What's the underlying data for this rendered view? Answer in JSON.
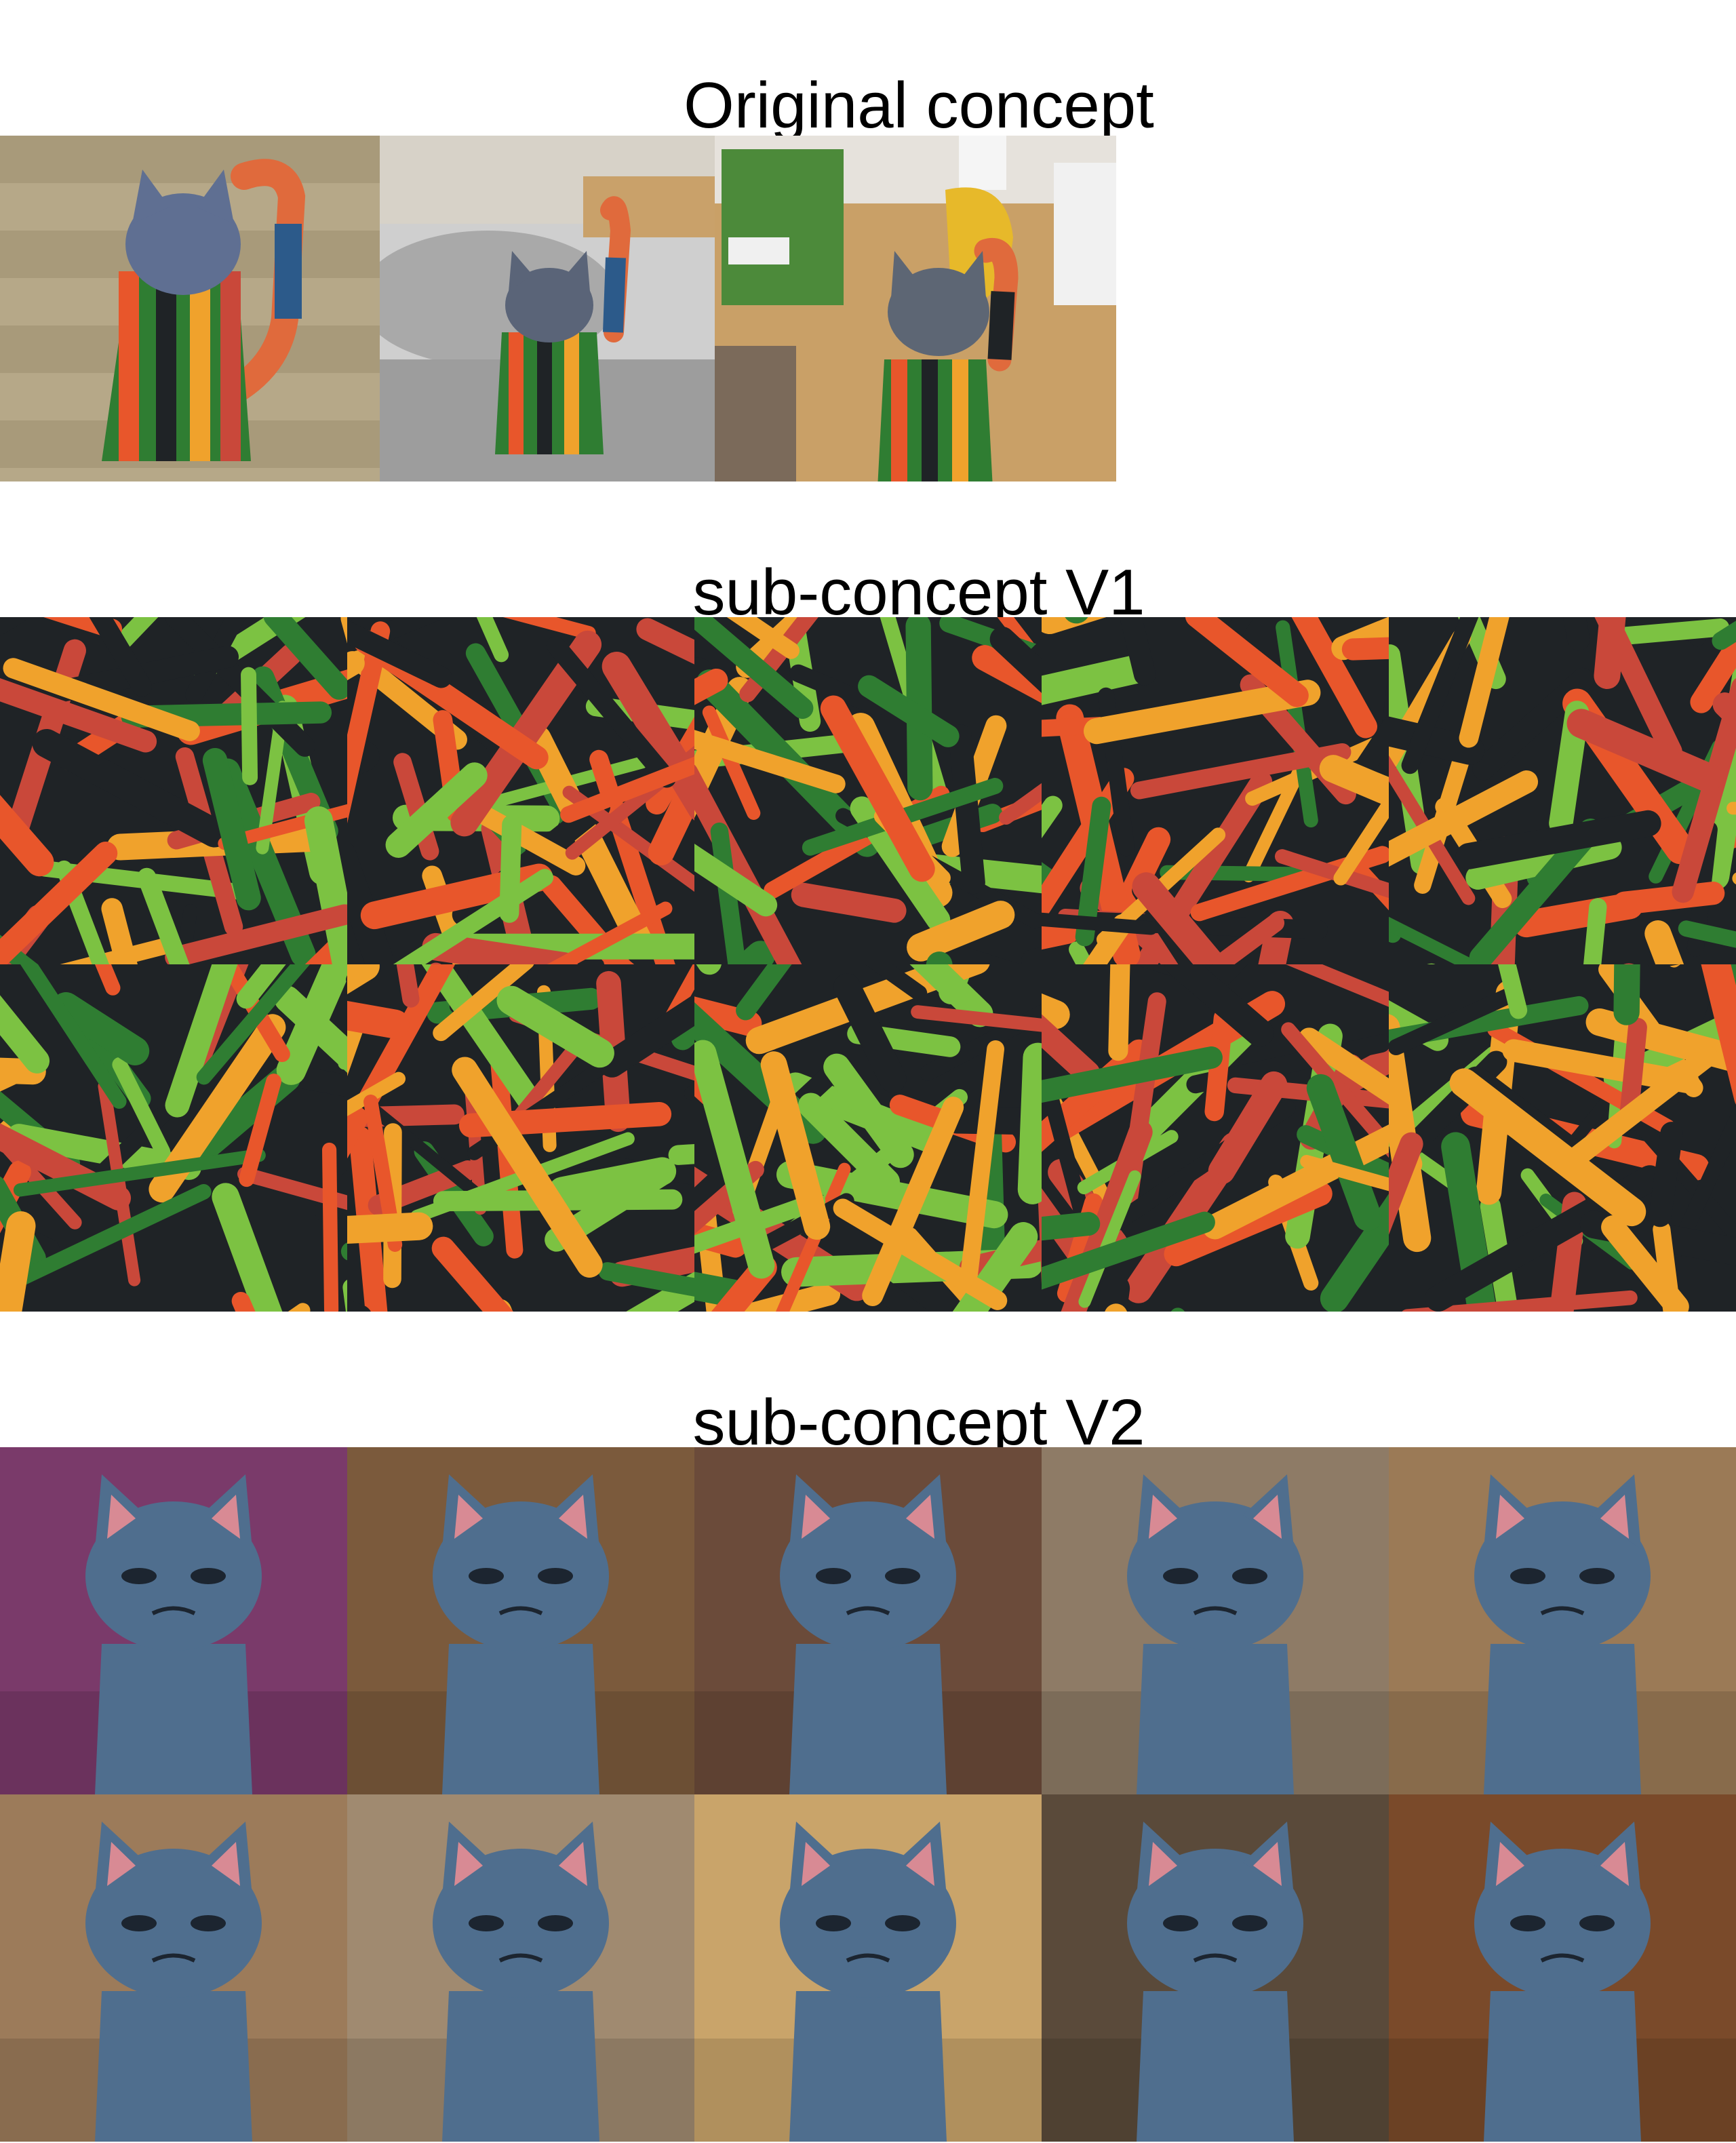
{
  "sections": {
    "original": {
      "title": "Original concept"
    },
    "v1": {
      "title": "sub-concept V1"
    },
    "v2": {
      "title": "sub-concept V2"
    }
  },
  "stripe_palette": [
    "#e8562b",
    "#2f7d32",
    "#1f2326",
    "#f0a22c",
    "#7cc242",
    "#c9483a"
  ],
  "v2_backgrounds": [
    "#7a3a6a",
    "#7b5a3c",
    "#6b4b3a",
    "#8e7b66",
    "#9b7a56",
    "#9c7b5a",
    "#a08a70",
    "#c9a46a",
    "#5a4a3a",
    "#7a4a2a"
  ],
  "cat_color": "#4f6e8e"
}
